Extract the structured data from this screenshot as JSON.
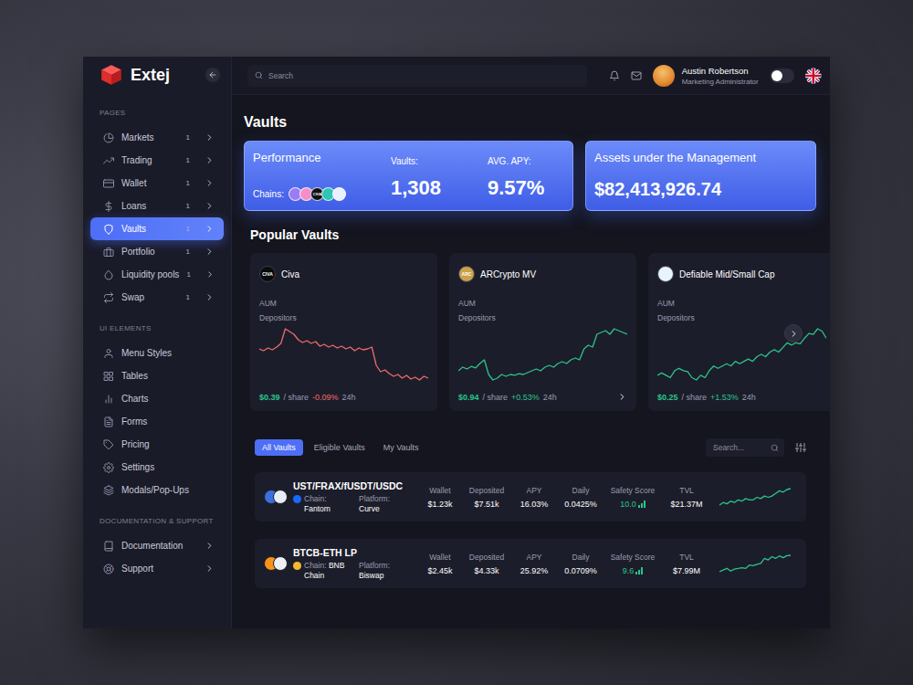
{
  "brand": {
    "name": "Extej"
  },
  "sidebar": {
    "sections": [
      {
        "title": "PAGES",
        "items": [
          {
            "label": "Markets",
            "badge": "1",
            "selected": false,
            "submenu": true
          },
          {
            "label": "Trading",
            "badge": "1",
            "selected": false,
            "submenu": true
          },
          {
            "label": "Wallet",
            "badge": "1",
            "selected": false,
            "submenu": true
          },
          {
            "label": "Loans",
            "badge": "1",
            "selected": false,
            "submenu": true
          },
          {
            "label": "Vaults",
            "badge": "1",
            "selected": true,
            "submenu": true
          },
          {
            "label": "Portfolio",
            "badge": "1",
            "selected": false,
            "submenu": true
          },
          {
            "label": "Liquidity pools",
            "badge": "1",
            "selected": false,
            "submenu": true
          },
          {
            "label": "Swap",
            "badge": "1",
            "selected": false,
            "submenu": true
          }
        ]
      },
      {
        "title": "UI ELEMENTS",
        "items": [
          {
            "label": "Menu Styles",
            "selected": false,
            "submenu": false
          },
          {
            "label": "Tables",
            "selected": false,
            "submenu": false
          },
          {
            "label": "Charts",
            "selected": false,
            "submenu": false
          },
          {
            "label": "Forms",
            "selected": false,
            "submenu": false
          },
          {
            "label": "Pricing",
            "selected": false,
            "submenu": false
          },
          {
            "label": "Settings",
            "selected": false,
            "submenu": false
          },
          {
            "label": "Modals/Pop-Ups",
            "selected": false,
            "submenu": false
          }
        ]
      },
      {
        "title": "DOCUMENTATION & SUPPORT",
        "items": [
          {
            "label": "Documentation",
            "selected": false,
            "submenu": true
          },
          {
            "label": "Support",
            "selected": false,
            "submenu": true
          }
        ]
      }
    ]
  },
  "topbar": {
    "search_placeholder": "Search",
    "user": {
      "name": "Austin Robertson",
      "role": "Marketing Administrator"
    },
    "theme_toggle": {
      "on": false
    }
  },
  "page": {
    "title": "Vaults"
  },
  "performance": {
    "title": "Performance",
    "chains_label": "Chains:",
    "chains": [
      {
        "color": "#9b7cf4",
        "text": ""
      },
      {
        "color": "#f28fc8",
        "text": ""
      },
      {
        "color": "#111111",
        "text": "CIVA"
      },
      {
        "color": "#2ec4b6",
        "text": ""
      },
      {
        "color": "#e9f0ff",
        "text": ""
      }
    ],
    "stats": [
      {
        "label": "Vaults:",
        "value": "1,308"
      },
      {
        "label": "AVG. APY:",
        "value": "9.57%"
      }
    ]
  },
  "aum": {
    "label": "Assets under the Management",
    "value": "$82,413,926.74"
  },
  "popular": {
    "title": "Popular Vaults",
    "cards": [
      {
        "name": "Civa",
        "logo_color": "#0b0b0b",
        "logo_text": "CIVA",
        "aum_label": "AUM",
        "depositors_label": "Depositors",
        "price": "$0.39",
        "unit": "/ share",
        "change": "-0.09%",
        "period": "24h",
        "trend": "down",
        "has_link": false,
        "series": [
          0.43,
          0.428,
          0.431,
          0.429,
          0.432,
          0.436,
          0.452,
          0.449,
          0.446,
          0.44,
          0.437,
          0.439,
          0.436,
          0.438,
          0.433,
          0.435,
          0.432,
          0.434,
          0.431,
          0.433,
          0.43,
          0.432,
          0.428,
          0.431,
          0.429,
          0.43,
          0.432,
          0.412,
          0.405,
          0.407,
          0.403,
          0.4,
          0.402,
          0.398,
          0.401,
          0.397,
          0.399,
          0.396,
          0.4,
          0.398
        ]
      },
      {
        "name": "ARCrypto MV",
        "logo_color": "#c9a24a",
        "logo_text": "ARC",
        "aum_label": "AUM",
        "depositors_label": "Depositors",
        "price": "$0.94",
        "unit": "/ share",
        "change": "+0.53%",
        "period": "24h",
        "trend": "up",
        "has_link": true,
        "series": [
          0.8,
          0.81,
          0.805,
          0.812,
          0.808,
          0.82,
          0.83,
          0.79,
          0.775,
          0.78,
          0.79,
          0.785,
          0.79,
          0.788,
          0.792,
          0.79,
          0.795,
          0.8,
          0.805,
          0.8,
          0.81,
          0.815,
          0.81,
          0.82,
          0.825,
          0.82,
          0.83,
          0.835,
          0.83,
          0.86,
          0.87,
          0.865,
          0.9,
          0.905,
          0.91,
          0.9,
          0.915,
          0.91,
          0.905,
          0.9
        ]
      },
      {
        "name": "Defiable Mid/Small Cap",
        "logo_color": "#e8f4fb",
        "logo_text": "",
        "aum_label": "AUM",
        "depositors_label": "Depositors",
        "price": "$0.25",
        "unit": "/ share",
        "change": "+1.53%",
        "period": "24h",
        "trend": "up",
        "has_link": false,
        "series": [
          0.19,
          0.195,
          0.19,
          0.185,
          0.2,
          0.205,
          0.2,
          0.198,
          0.185,
          0.18,
          0.19,
          0.185,
          0.2,
          0.21,
          0.205,
          0.21,
          0.215,
          0.21,
          0.22,
          0.215,
          0.22,
          0.225,
          0.22,
          0.23,
          0.235,
          0.23,
          0.24,
          0.245,
          0.24,
          0.25,
          0.26,
          0.255,
          0.26,
          0.258,
          0.27,
          0.28,
          0.278,
          0.29,
          0.285,
          0.27
        ]
      }
    ]
  },
  "vault_tabs": [
    {
      "label": "All Vaults",
      "selected": true
    },
    {
      "label": "Eligible Vaults",
      "selected": false
    },
    {
      "label": "My Vaults",
      "selected": false
    }
  ],
  "vault_search": {
    "placeholder": "Search..."
  },
  "table": {
    "columns": [
      {
        "label": "Wallet",
        "kind": "text"
      },
      {
        "label": "Deposited",
        "kind": "text"
      },
      {
        "label": "APY",
        "kind": "text"
      },
      {
        "label": "Daily",
        "kind": "text"
      },
      {
        "label": "Safety Score",
        "kind": "score"
      },
      {
        "label": "TVL",
        "kind": "text"
      }
    ],
    "rows": [
      {
        "name": "UST/FRAX/fUSDT/USDC",
        "tokens": [
          {
            "color": "#3b6fe0"
          },
          {
            "color": "#e8ecf5"
          }
        ],
        "chain_label": "Chain:",
        "chain": "Fantom",
        "chain_color": "#1969ff",
        "platform_label": "Platform:",
        "platform": "Curve",
        "values": [
          "$1.23k",
          "$7.51k",
          "16.03%",
          "0.0425%",
          "10.0",
          "$21.37M"
        ],
        "series": [
          20.1,
          20.3,
          20.2,
          20.4,
          20.3,
          20.5,
          20.4,
          20.6,
          20.5,
          20.5,
          20.7,
          20.6,
          20.8,
          20.7,
          20.8,
          21.0,
          21.2,
          21.1,
          21.3,
          21.37
        ]
      },
      {
        "name": "BTCB-ETH LP",
        "tokens": [
          {
            "color": "#f7931a"
          },
          {
            "color": "#eef0f6"
          }
        ],
        "chain_label": "Chain:",
        "chain": "BNB Chain",
        "chain_color": "#f3ba2f",
        "platform_label": "Platform:",
        "platform": "Biswap",
        "values": [
          "$2.45k",
          "$4.33k",
          "25.92%",
          "0.0709%",
          "9.6",
          "$7.99M"
        ],
        "series": [
          7.5,
          7.55,
          7.6,
          7.52,
          7.58,
          7.6,
          7.62,
          7.6,
          7.7,
          7.68,
          7.72,
          7.75,
          7.9,
          7.85,
          7.95,
          7.9,
          7.97,
          7.92,
          7.98,
          7.99
        ]
      }
    ]
  }
}
